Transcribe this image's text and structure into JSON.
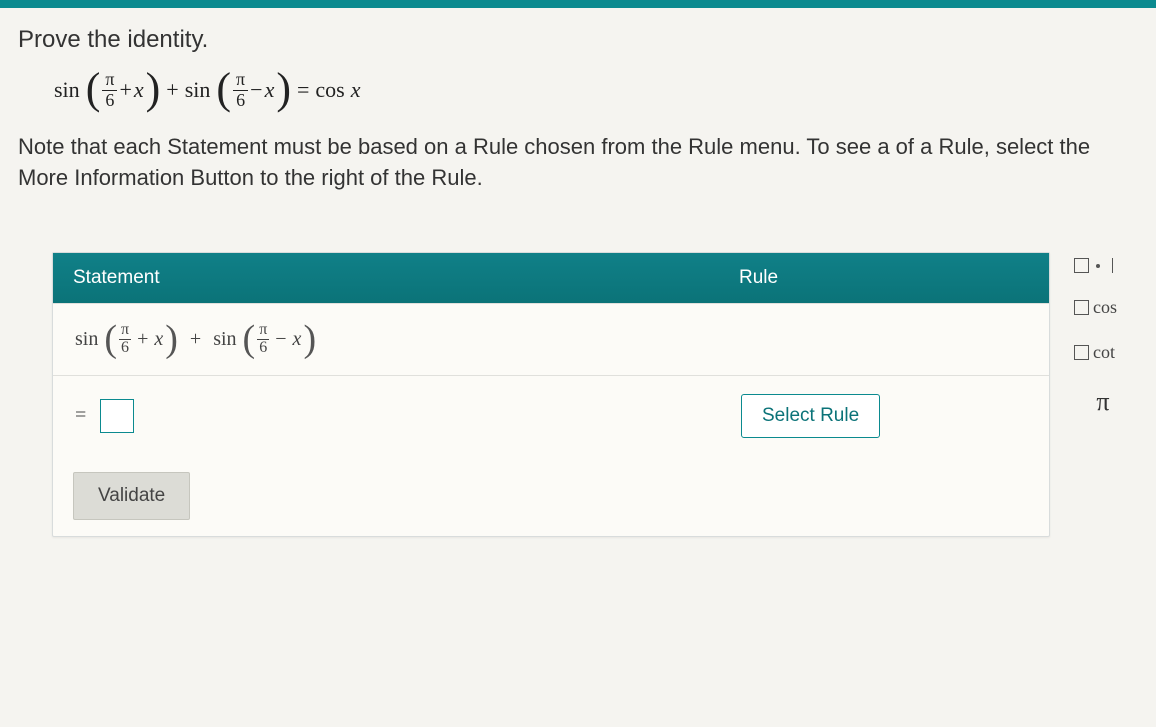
{
  "prompt": {
    "title": "Prove the identity.",
    "identity": {
      "func1": "sin",
      "frac1_num": "π",
      "frac1_den": "6",
      "op1": "+",
      "var1": "x",
      "plus": "+",
      "func2": "sin",
      "frac2_num": "π",
      "frac2_den": "6",
      "op2": "−",
      "var2": "x",
      "equals": "=",
      "rhs_func": "cos",
      "rhs_var": "x"
    },
    "note": "Note that each Statement must be based on a Rule chosen from the Rule menu. To see a of a Rule, select the More Information Button to the right of the Rule."
  },
  "table": {
    "header_statement": "Statement",
    "header_rule": "Rule",
    "row1": {
      "func1": "sin",
      "frac1_num": "π",
      "frac1_den": "6",
      "op1": "+",
      "var1": "x",
      "plus": "+",
      "func2": "sin",
      "frac2_num": "π",
      "frac2_den": "6",
      "op2": "−",
      "var2": "x"
    },
    "row2_eq": "=",
    "select_rule_label": "Select Rule",
    "validate_label": "Validate"
  },
  "sidepanel": {
    "cos": "cos",
    "cot": "cot",
    "pi": "π"
  }
}
